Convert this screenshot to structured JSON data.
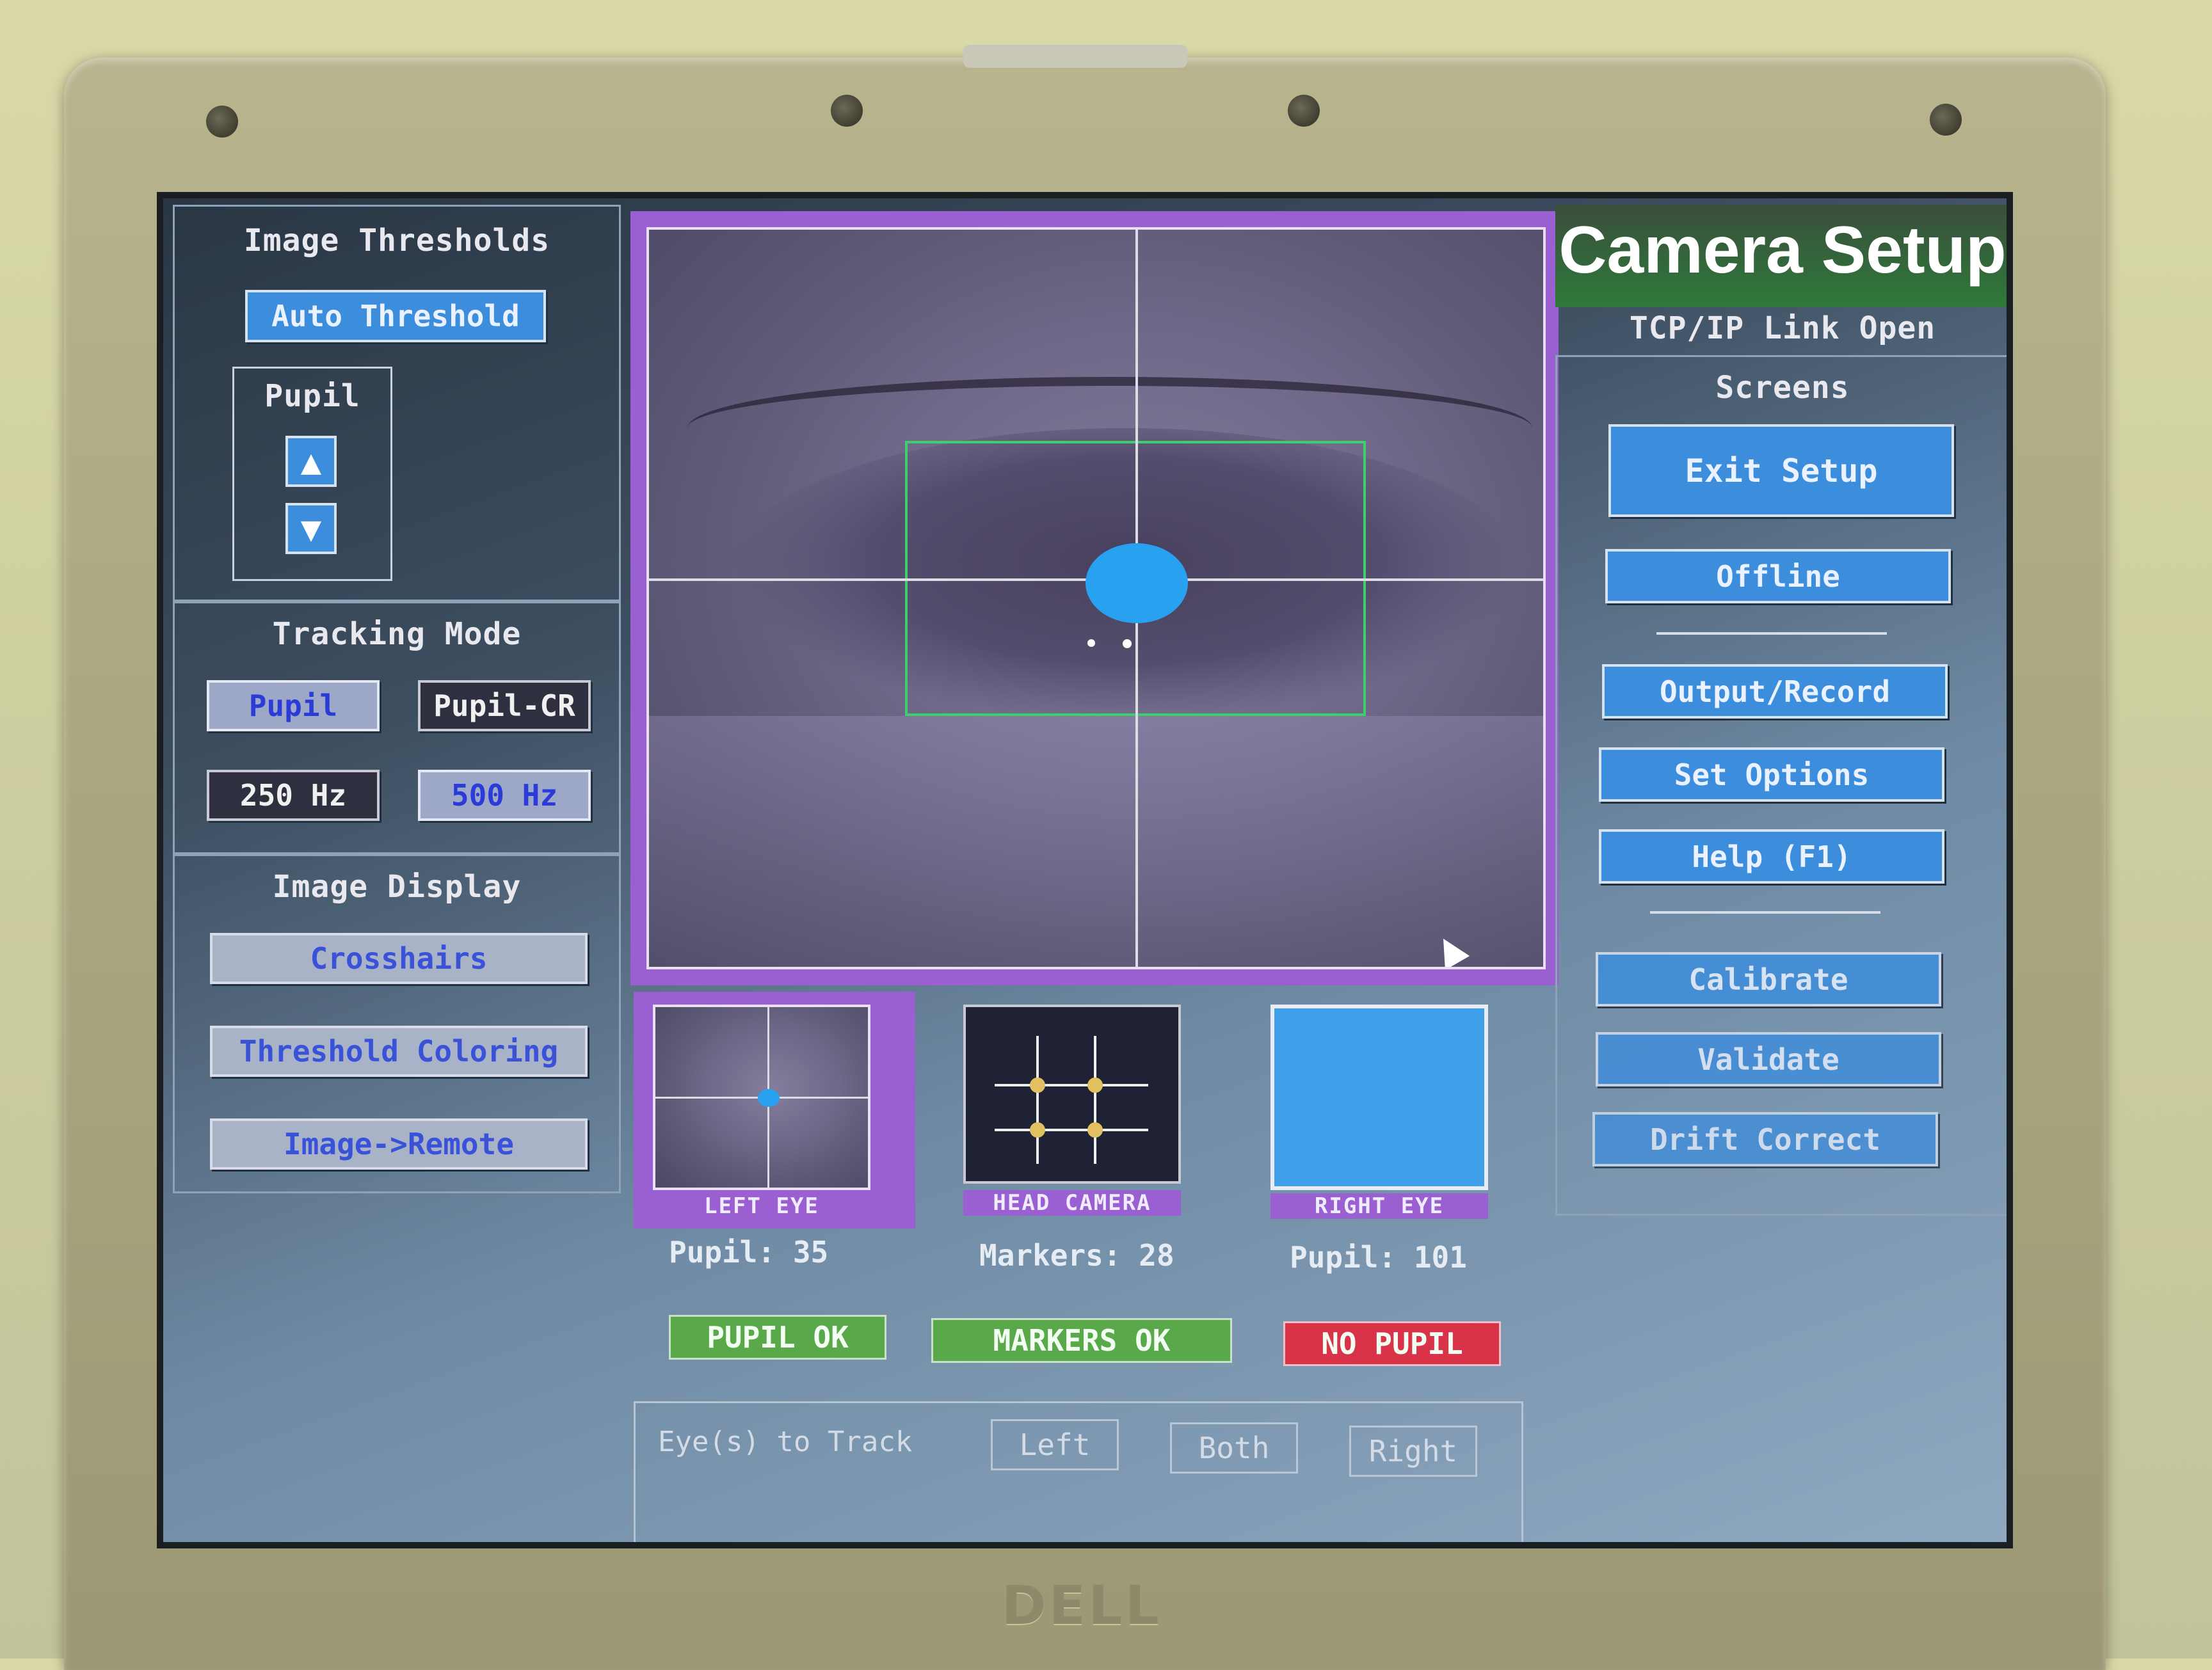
{
  "left_panel": {
    "image_thresholds": {
      "title": "Image Thresholds",
      "auto_threshold": "Auto Threshold",
      "pupil_label": "Pupil",
      "up_icon": "arrow-up-icon",
      "down_icon": "arrow-down-icon"
    },
    "tracking_mode": {
      "title": "Tracking Mode",
      "pupil": "Pupil",
      "pupil_cr": "Pupil-CR",
      "hz_250": "250 Hz",
      "hz_500": "500 Hz"
    },
    "image_display": {
      "title": "Image Display",
      "crosshairs": "Crosshairs",
      "threshold_coloring": "Threshold Coloring",
      "image_remote": "Image->Remote"
    }
  },
  "center": {
    "thumbnails": {
      "left_eye": "LEFT EYE",
      "head_camera": "HEAD CAMERA",
      "right_eye": "RIGHT EYE"
    },
    "readouts": {
      "left_pupil": "Pupil: 35",
      "markers": "Markers: 28",
      "right_pupil": "Pupil: 101"
    },
    "statuses": {
      "pupil_ok": "PUPIL OK",
      "markers_ok": "MARKERS  OK",
      "no_pupil": "NO PUPIL"
    },
    "eyes_to_track": {
      "label": "Eye(s) to Track",
      "left": "Left",
      "both": "Both",
      "right": "Right"
    }
  },
  "right_panel": {
    "title": "Camera Setup",
    "link_status": "TCP/IP Link Open",
    "screens_label": "Screens",
    "buttons": {
      "exit_setup": "Exit Setup",
      "offline": "Offline",
      "output_record": "Output/Record",
      "set_options": "Set Options",
      "help": "Help (F1)",
      "calibrate": "Calibrate",
      "validate": "Validate",
      "drift_correct": "Drift Correct"
    }
  },
  "laptop": {
    "brand": "DELL"
  },
  "colors": {
    "accent_blue": "#3d8ddd",
    "status_green": "#59a84a",
    "status_red": "#d9334a",
    "frame_purple": "#9a5fd0",
    "title_green": "#2e7a3a"
  }
}
